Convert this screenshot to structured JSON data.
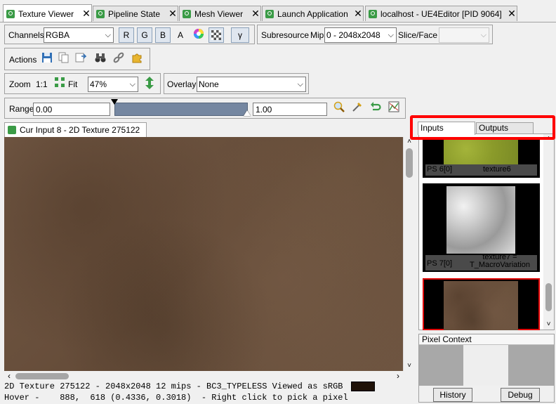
{
  "tabs": [
    {
      "label": "Texture Viewer",
      "active": true
    },
    {
      "label": "Pipeline State",
      "active": false
    },
    {
      "label": "Mesh Viewer",
      "active": false
    },
    {
      "label": "Launch Application",
      "active": false
    },
    {
      "label": "localhost - UE4Editor [PID 9064]",
      "active": false
    }
  ],
  "tab_close_glyph": "✕",
  "channels": {
    "label": "Channels",
    "value": "RGBA",
    "r": "R",
    "g": "G",
    "b": "B",
    "a": "A",
    "gamma": "γ"
  },
  "subresource": {
    "label": "Subresource",
    "mip_label": "Mip",
    "mip_value": "0 - 2048x2048",
    "slice_label": "Slice/Face",
    "slice_value": ""
  },
  "actions": {
    "label": "Actions"
  },
  "zoom": {
    "label": "Zoom",
    "one_to_one": "1:1",
    "fit": "Fit",
    "value": "47%"
  },
  "overlay": {
    "label": "Overlay",
    "value": "None"
  },
  "range": {
    "label": "Range",
    "min": "0.00",
    "max": "1.00"
  },
  "viewer_tab": {
    "label": "Cur Input 8 - 2D Texture 275122"
  },
  "status": {
    "line1": "2D Texture 275122 -  2048x2048 12 mips -  BC3_TYPELESS Viewed as sRGB",
    "line2": "Hover -    888,  618 (0.4336, 0.3018)  - Right click to pick a pixel",
    "color_swatch": "#1f1208"
  },
  "side_tabs": {
    "inputs": "Inputs",
    "outputs": "Outputs"
  },
  "thumbnails": [
    {
      "slot": "PS 6[0]",
      "name": "texture6"
    },
    {
      "slot": "PS 7[0]",
      "name": "texture7 =\nT_MacroVariation"
    },
    {
      "slot": "",
      "name": ""
    }
  ],
  "pixel_context": {
    "title": "Pixel Context",
    "history_button": "History",
    "debug_button": "Debug"
  },
  "colors": {
    "highlight_red": "#ff0000",
    "range_bar": "#7587a1",
    "selected_border": "#e00000"
  }
}
